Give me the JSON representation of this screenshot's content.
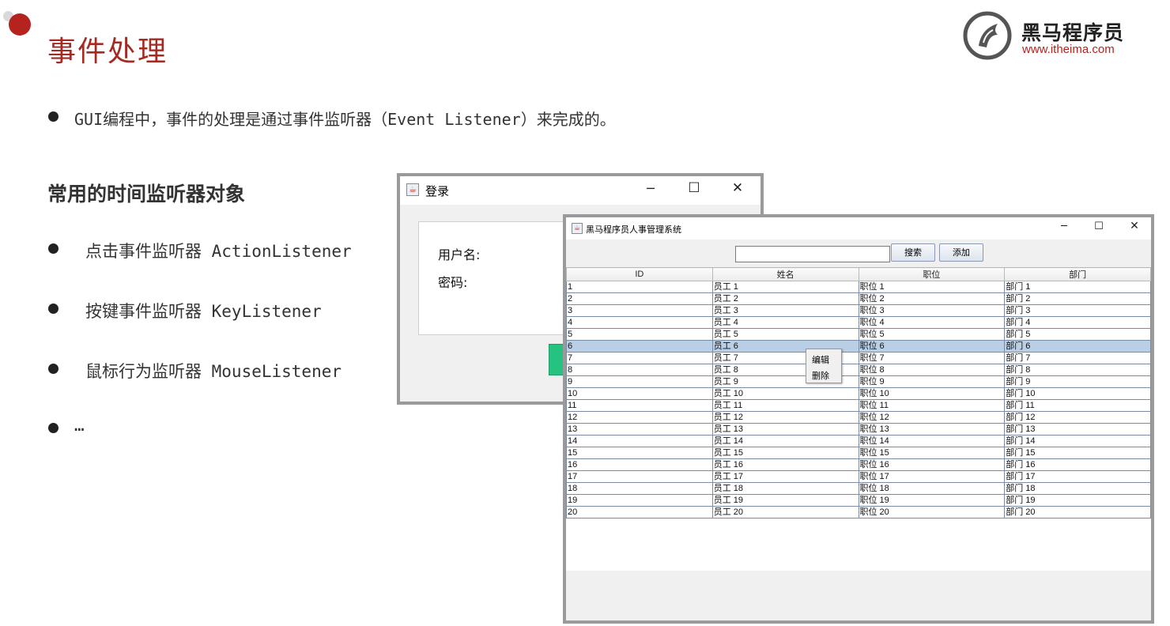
{
  "slide": {
    "title": "事件处理",
    "intro": "GUI编程中，事件的处理是通过事件监听器（Event Listener）来完成的。",
    "subheading": "常用的时间监听器对象",
    "bullets": [
      "点击事件监听器 ActionListener",
      "按键事件监听器 KeyListener",
      "鼠标行为监听器 MouseListener",
      "…"
    ]
  },
  "logo": {
    "name": "黑马程序员",
    "url": "www.itheima.com"
  },
  "login_window": {
    "title": "登录",
    "username_label": "用户名:",
    "password_label": "密码:",
    "controls": {
      "minimize": "─",
      "maximize": "☐",
      "close": "✕"
    }
  },
  "main_window": {
    "title": "黑马程序员人事管理系统",
    "controls": {
      "minimize": "─",
      "maximize": "☐",
      "close": "✕"
    },
    "search_value": "",
    "search_button": "搜索",
    "add_button": "添加",
    "table": {
      "columns": [
        "ID",
        "姓名",
        "职位",
        "部门"
      ],
      "selected_row": 6,
      "rows": [
        [
          "1",
          "员工 1",
          "职位 1",
          "部门 1"
        ],
        [
          "2",
          "员工 2",
          "职位 2",
          "部门 2"
        ],
        [
          "3",
          "员工 3",
          "职位 3",
          "部门 3"
        ],
        [
          "4",
          "员工 4",
          "职位 4",
          "部门 4"
        ],
        [
          "5",
          "员工 5",
          "职位 5",
          "部门 5"
        ],
        [
          "6",
          "员工 6",
          "职位 6",
          "部门 6"
        ],
        [
          "7",
          "员工 7",
          "职位 7",
          "部门 7"
        ],
        [
          "8",
          "员工 8",
          "职位 8",
          "部门 8"
        ],
        [
          "9",
          "员工 9",
          "职位 9",
          "部门 9"
        ],
        [
          "10",
          "员工 10",
          "职位 10",
          "部门 10"
        ],
        [
          "11",
          "员工 11",
          "职位 11",
          "部门 11"
        ],
        [
          "12",
          "员工 12",
          "职位 12",
          "部门 12"
        ],
        [
          "13",
          "员工 13",
          "职位 13",
          "部门 13"
        ],
        [
          "14",
          "员工 14",
          "职位 14",
          "部门 14"
        ],
        [
          "15",
          "员工 15",
          "职位 15",
          "部门 15"
        ],
        [
          "16",
          "员工 16",
          "职位 16",
          "部门 16"
        ],
        [
          "17",
          "员工 17",
          "职位 17",
          "部门 17"
        ],
        [
          "18",
          "员工 18",
          "职位 18",
          "部门 18"
        ],
        [
          "19",
          "员工 19",
          "职位 19",
          "部门 19"
        ],
        [
          "20",
          "员工 20",
          "职位 20",
          "部门 20"
        ]
      ]
    },
    "context_menu": {
      "edit": "编辑",
      "delete": "删除"
    }
  },
  "colors": {
    "accent_red": "#b5231f",
    "selection": "#b8cfe5",
    "green_button": "#26c281"
  }
}
